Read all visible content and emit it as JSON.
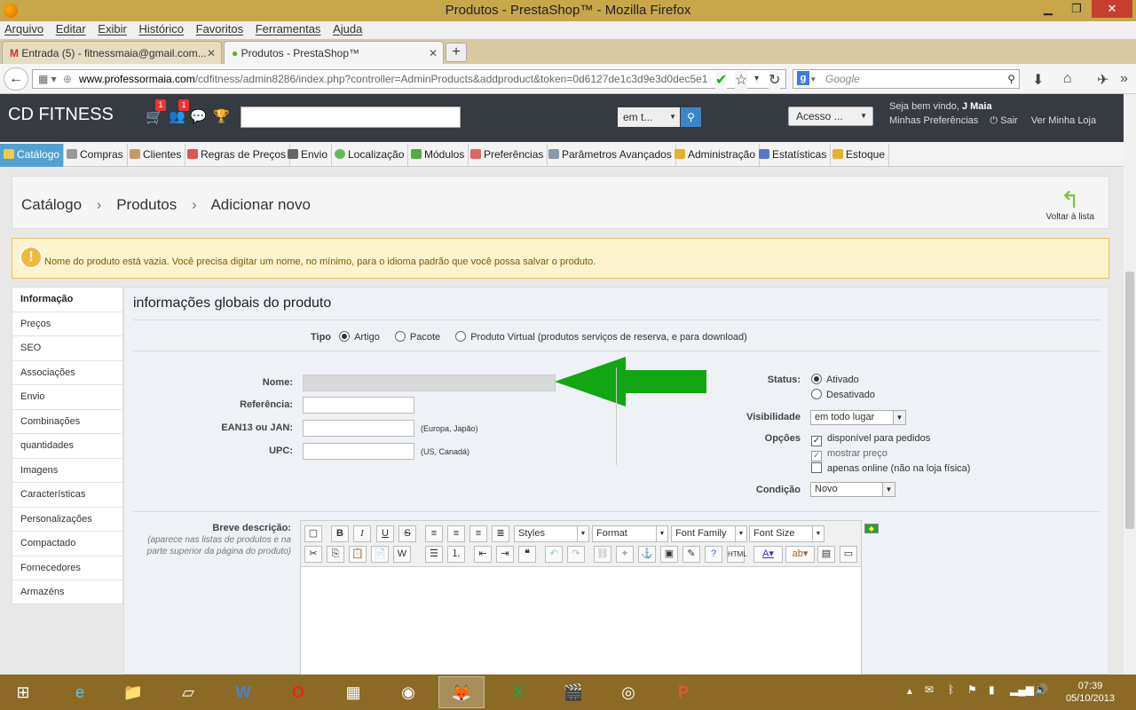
{
  "window": {
    "title": "Produtos - PrestaShop™ - Mozilla Firefox"
  },
  "menubar": [
    "Arquivo",
    "Editar",
    "Exibir",
    "Histórico",
    "Favoritos",
    "Ferramentas",
    "Ajuda"
  ],
  "tabs": [
    {
      "label": "Entrada (5) - fitnessmaia@gmail.com..."
    },
    {
      "label": "Produtos - PrestaShop™"
    }
  ],
  "address": {
    "domain": "www.professormaia.com",
    "path": "/cdfitness/admin8286/index.php?controller=AdminProducts&addproduct&token=0d6127de1c3d9e3d0dec5e1",
    "search_placeholder": "Google"
  },
  "admin": {
    "brand": "CD FITNESS",
    "badges": [
      "1",
      "1"
    ],
    "search_scope": "em t...",
    "acesso": "Acesso ...",
    "welcome_prefix": "Seja bem vindo, ",
    "user": "J Maia",
    "prefs": "Minhas Preferências",
    "logout": "Sair",
    "view_store": "Ver Minha Loja"
  },
  "modules": [
    "Catálogo",
    "Compras",
    "Clientes",
    "Regras de Preços",
    "Envio",
    "Localização",
    "Módulos",
    "Preferências",
    "Parâmetros Avançados",
    "Administração",
    "Estatísticas",
    "Estoque"
  ],
  "breadcrumb": {
    "a": "Catálogo",
    "b": "Produtos",
    "c": "Adicionar novo",
    "back": "Voltar à lista"
  },
  "warning": "Nome do produto está vazia. Você precisa digitar um nome, no mínimo, para o idioma padrão que você possa salvar o produto.",
  "side_menu": [
    "Informação",
    "Preços",
    "SEO",
    "Associações",
    "Envio",
    "Combinações",
    "quantidades",
    "Imagens",
    "Características",
    "Personalizações",
    "Compactado",
    "Fornecedores",
    "Armazéns"
  ],
  "form": {
    "title": "informações globais do produto",
    "tipo_label": "Tipo",
    "tipo_options": [
      "Artigo",
      "Pacote",
      "Produto Virtual (produtos serviços de reserva, e para download)"
    ],
    "nome": "Nome:",
    "referencia": "Referência:",
    "ean": "EAN13 ou JAN:",
    "ean_hint": "(Europa, Japão)",
    "upc": "UPC:",
    "upc_hint": "(US, Canadá)",
    "status": "Status:",
    "status_on": "Ativado",
    "status_off": "Desativado",
    "visibilidade": "Visibilidade",
    "visibilidade_val": "em todo lugar",
    "opcoes": "Opções",
    "opt1": "disponível para pedidos",
    "opt2": "mostrar preço",
    "opt3": "apenas online (não na loja física)",
    "condicao": "Condição",
    "condicao_val": "Novo",
    "breve": "Breve descrição:",
    "breve_hint": "(aparece nas listas de produtos e na parte superior da página do produto)",
    "editor": {
      "styles": "Styles",
      "format": "Format",
      "family": "Font Family",
      "size": "Font Size"
    }
  },
  "taskbar": {
    "time": "07:39",
    "date": "05/10/2013"
  }
}
